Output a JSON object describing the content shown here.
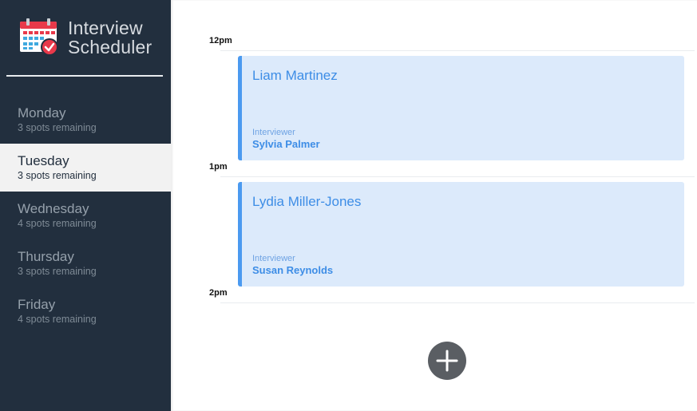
{
  "app": {
    "title_line1": "Interview",
    "title_line2": "Scheduler",
    "icon": "calendar-check-icon"
  },
  "days": [
    {
      "name": "Monday",
      "spots": "3 spots remaining",
      "selected": false
    },
    {
      "name": "Tuesday",
      "spots": "3 spots remaining",
      "selected": true
    },
    {
      "name": "Wednesday",
      "spots": "4 spots remaining",
      "selected": false
    },
    {
      "name": "Thursday",
      "spots": "3 spots remaining",
      "selected": false
    },
    {
      "name": "Friday",
      "spots": "4 spots remaining",
      "selected": false
    }
  ],
  "schedule": {
    "times": [
      "12pm",
      "1pm",
      "2pm"
    ],
    "appointments": [
      {
        "student": "Liam Martinez",
        "interviewer_caption": "Interviewer",
        "interviewer": "Sylvia Palmer"
      },
      {
        "student": "Lydia Miller-Jones",
        "interviewer_caption": "Interviewer",
        "interviewer": "Susan Reynolds"
      }
    ],
    "add_icon": "plus-icon"
  },
  "colors": {
    "sidebar_bg": "#222f3e",
    "selected_day_bg": "#f2f2f2",
    "appointment_bg": "#dceafb",
    "appointment_accent": "#4b9af0",
    "add_button_bg": "#5a5e63"
  }
}
